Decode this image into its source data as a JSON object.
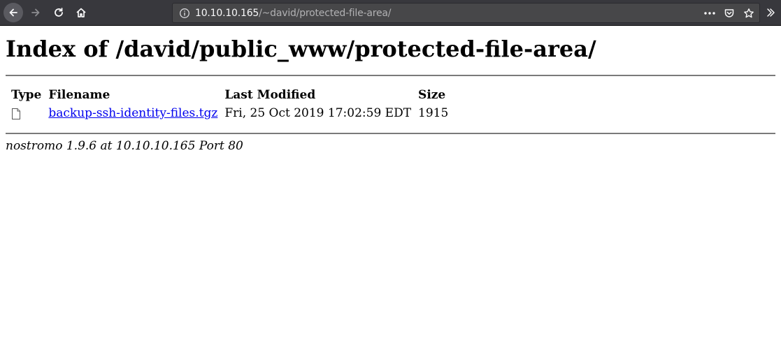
{
  "browser": {
    "url_host": "10.10.10.165",
    "url_path": "/~david/protected-file-area/",
    "icons": [
      "back-arrow-icon",
      "forward-arrow-icon",
      "reload-icon",
      "home-icon",
      "info-icon",
      "more-actions-icon",
      "pocket-icon",
      "star-icon",
      "overflow-chevron-icon"
    ]
  },
  "page": {
    "title": "Index of /david/public_www/protected-file-area/",
    "columns": {
      "type": "Type",
      "filename": "Filename",
      "last_modified": "Last Modified",
      "size": "Size"
    },
    "files": [
      {
        "type_icon": "file-icon",
        "filename": "backup-ssh-identity-files.tgz",
        "last_modified": "Fri, 25 Oct 2019 17:02:59 EDT",
        "size": "1915"
      }
    ],
    "footer": "nostromo 1.9.6 at 10.10.10.165 Port 80"
  },
  "colors": {
    "chrome_bg": "#38383d",
    "urlbar_bg": "#474749",
    "link": "#0000ee"
  }
}
